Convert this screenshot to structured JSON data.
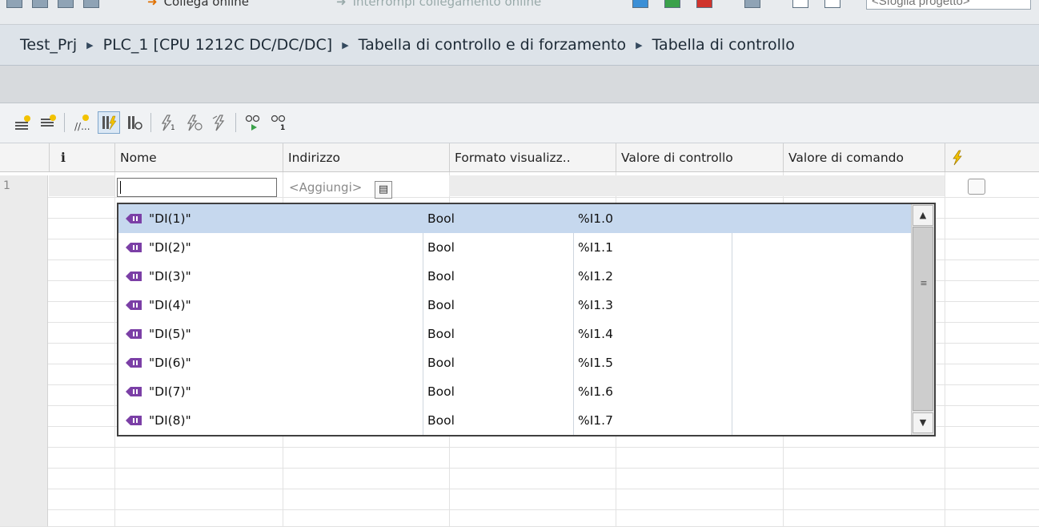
{
  "topbar": {
    "collega_online_label": "Collega online",
    "interrompi_label": "Interrompi collegamento online",
    "search_placeholder": "<Sfoglia progetto>"
  },
  "breadcrumb": {
    "items": [
      "Test_Prj",
      "PLC_1 [CPU 1212C DC/DC/DC]",
      "Tabella di controllo e di forzamento",
      "Tabella di controllo"
    ]
  },
  "table": {
    "columns": {
      "info": "i",
      "nome": "Nome",
      "indirizzo": "Indirizzo",
      "formato": "Formato visualizz..",
      "valore_controllo": "Valore di controllo",
      "valore_comando": "Valore di comando"
    },
    "row1": {
      "number": "1",
      "name_value": "",
      "address_placeholder": "<Aggiungi>",
      "modify_checked": false
    }
  },
  "dropdown": {
    "selected_index": 0,
    "items": [
      {
        "name": "\"DI(1)\"",
        "type": "Bool",
        "address": "%I1.0"
      },
      {
        "name": "\"DI(2)\"",
        "type": "Bool",
        "address": "%I1.1"
      },
      {
        "name": "\"DI(3)\"",
        "type": "Bool",
        "address": "%I1.2"
      },
      {
        "name": "\"DI(4)\"",
        "type": "Bool",
        "address": "%I1.3"
      },
      {
        "name": "\"DI(5)\"",
        "type": "Bool",
        "address": "%I1.4"
      },
      {
        "name": "\"DI(6)\"",
        "type": "Bool",
        "address": "%I1.5"
      },
      {
        "name": "\"DI(7)\"",
        "type": "Bool",
        "address": "%I1.6"
      },
      {
        "name": "\"DI(8)\"",
        "type": "Bool",
        "address": "%I1.7"
      }
    ]
  },
  "colors": {
    "selection": "#c6d8ee",
    "tag_icon": "#7b3fa6",
    "force_icon": "#e5b800"
  }
}
